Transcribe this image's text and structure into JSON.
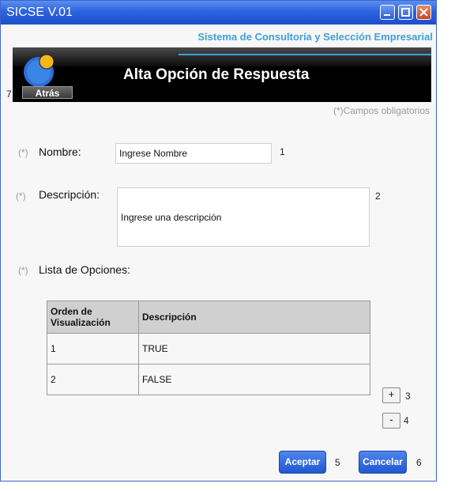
{
  "window": {
    "title": "SICSE V.01",
    "minimize_icon": "minimize-icon",
    "maximize_icon": "maximize-icon",
    "close_icon": "close-icon"
  },
  "header": {
    "tagline": "Sistema de Consultoría y Selección Empresarial",
    "page_title": "Alta Opción de Respuesta",
    "back_label": "Atrás",
    "logo_icon": "pie-logo-icon",
    "accent_color": "#3fa0d6"
  },
  "form": {
    "required_note": "(*)Campos obligatorios",
    "required_mark": "(*)",
    "nombre": {
      "label": "Nombre:",
      "value": "Ingrese Nombre",
      "marker": "1"
    },
    "descripcion": {
      "label": "Descripción:",
      "value": "Ingrese una descripción",
      "marker": "2"
    },
    "lista_label": "Lista de Opciones:",
    "back_marker": "7"
  },
  "options_table": {
    "headers": [
      "Orden de Visualización",
      "Descripción"
    ],
    "rows": [
      {
        "orden": "1",
        "descripcion": "TRUE"
      },
      {
        "orden": "2",
        "descripcion": "FALSE"
      }
    ]
  },
  "controls": {
    "add": {
      "label": "+",
      "marker": "3"
    },
    "remove": {
      "label": "-",
      "marker": "4"
    },
    "accept": {
      "label": "Aceptar",
      "marker": "5"
    },
    "cancel": {
      "label": "Cancelar",
      "marker": "6"
    }
  }
}
